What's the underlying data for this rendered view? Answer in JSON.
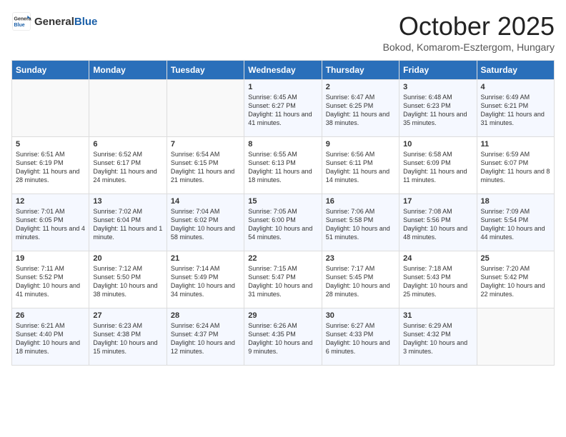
{
  "header": {
    "logo_general": "General",
    "logo_blue": "Blue",
    "month_title": "October 2025",
    "subtitle": "Bokod, Komarom-Esztergom, Hungary"
  },
  "days_of_week": [
    "Sunday",
    "Monday",
    "Tuesday",
    "Wednesday",
    "Thursday",
    "Friday",
    "Saturday"
  ],
  "weeks": [
    [
      {
        "day": "",
        "content": ""
      },
      {
        "day": "",
        "content": ""
      },
      {
        "day": "",
        "content": ""
      },
      {
        "day": "1",
        "content": "Sunrise: 6:45 AM\nSunset: 6:27 PM\nDaylight: 11 hours and 41 minutes."
      },
      {
        "day": "2",
        "content": "Sunrise: 6:47 AM\nSunset: 6:25 PM\nDaylight: 11 hours and 38 minutes."
      },
      {
        "day": "3",
        "content": "Sunrise: 6:48 AM\nSunset: 6:23 PM\nDaylight: 11 hours and 35 minutes."
      },
      {
        "day": "4",
        "content": "Sunrise: 6:49 AM\nSunset: 6:21 PM\nDaylight: 11 hours and 31 minutes."
      }
    ],
    [
      {
        "day": "5",
        "content": "Sunrise: 6:51 AM\nSunset: 6:19 PM\nDaylight: 11 hours and 28 minutes."
      },
      {
        "day": "6",
        "content": "Sunrise: 6:52 AM\nSunset: 6:17 PM\nDaylight: 11 hours and 24 minutes."
      },
      {
        "day": "7",
        "content": "Sunrise: 6:54 AM\nSunset: 6:15 PM\nDaylight: 11 hours and 21 minutes."
      },
      {
        "day": "8",
        "content": "Sunrise: 6:55 AM\nSunset: 6:13 PM\nDaylight: 11 hours and 18 minutes."
      },
      {
        "day": "9",
        "content": "Sunrise: 6:56 AM\nSunset: 6:11 PM\nDaylight: 11 hours and 14 minutes."
      },
      {
        "day": "10",
        "content": "Sunrise: 6:58 AM\nSunset: 6:09 PM\nDaylight: 11 hours and 11 minutes."
      },
      {
        "day": "11",
        "content": "Sunrise: 6:59 AM\nSunset: 6:07 PM\nDaylight: 11 hours and 8 minutes."
      }
    ],
    [
      {
        "day": "12",
        "content": "Sunrise: 7:01 AM\nSunset: 6:05 PM\nDaylight: 11 hours and 4 minutes."
      },
      {
        "day": "13",
        "content": "Sunrise: 7:02 AM\nSunset: 6:04 PM\nDaylight: 11 hours and 1 minute."
      },
      {
        "day": "14",
        "content": "Sunrise: 7:04 AM\nSunset: 6:02 PM\nDaylight: 10 hours and 58 minutes."
      },
      {
        "day": "15",
        "content": "Sunrise: 7:05 AM\nSunset: 6:00 PM\nDaylight: 10 hours and 54 minutes."
      },
      {
        "day": "16",
        "content": "Sunrise: 7:06 AM\nSunset: 5:58 PM\nDaylight: 10 hours and 51 minutes."
      },
      {
        "day": "17",
        "content": "Sunrise: 7:08 AM\nSunset: 5:56 PM\nDaylight: 10 hours and 48 minutes."
      },
      {
        "day": "18",
        "content": "Sunrise: 7:09 AM\nSunset: 5:54 PM\nDaylight: 10 hours and 44 minutes."
      }
    ],
    [
      {
        "day": "19",
        "content": "Sunrise: 7:11 AM\nSunset: 5:52 PM\nDaylight: 10 hours and 41 minutes."
      },
      {
        "day": "20",
        "content": "Sunrise: 7:12 AM\nSunset: 5:50 PM\nDaylight: 10 hours and 38 minutes."
      },
      {
        "day": "21",
        "content": "Sunrise: 7:14 AM\nSunset: 5:49 PM\nDaylight: 10 hours and 34 minutes."
      },
      {
        "day": "22",
        "content": "Sunrise: 7:15 AM\nSunset: 5:47 PM\nDaylight: 10 hours and 31 minutes."
      },
      {
        "day": "23",
        "content": "Sunrise: 7:17 AM\nSunset: 5:45 PM\nDaylight: 10 hours and 28 minutes."
      },
      {
        "day": "24",
        "content": "Sunrise: 7:18 AM\nSunset: 5:43 PM\nDaylight: 10 hours and 25 minutes."
      },
      {
        "day": "25",
        "content": "Sunrise: 7:20 AM\nSunset: 5:42 PM\nDaylight: 10 hours and 22 minutes."
      }
    ],
    [
      {
        "day": "26",
        "content": "Sunrise: 6:21 AM\nSunset: 4:40 PM\nDaylight: 10 hours and 18 minutes."
      },
      {
        "day": "27",
        "content": "Sunrise: 6:23 AM\nSunset: 4:38 PM\nDaylight: 10 hours and 15 minutes."
      },
      {
        "day": "28",
        "content": "Sunrise: 6:24 AM\nSunset: 4:37 PM\nDaylight: 10 hours and 12 minutes."
      },
      {
        "day": "29",
        "content": "Sunrise: 6:26 AM\nSunset: 4:35 PM\nDaylight: 10 hours and 9 minutes."
      },
      {
        "day": "30",
        "content": "Sunrise: 6:27 AM\nSunset: 4:33 PM\nDaylight: 10 hours and 6 minutes."
      },
      {
        "day": "31",
        "content": "Sunrise: 6:29 AM\nSunset: 4:32 PM\nDaylight: 10 hours and 3 minutes."
      },
      {
        "day": "",
        "content": ""
      }
    ]
  ]
}
